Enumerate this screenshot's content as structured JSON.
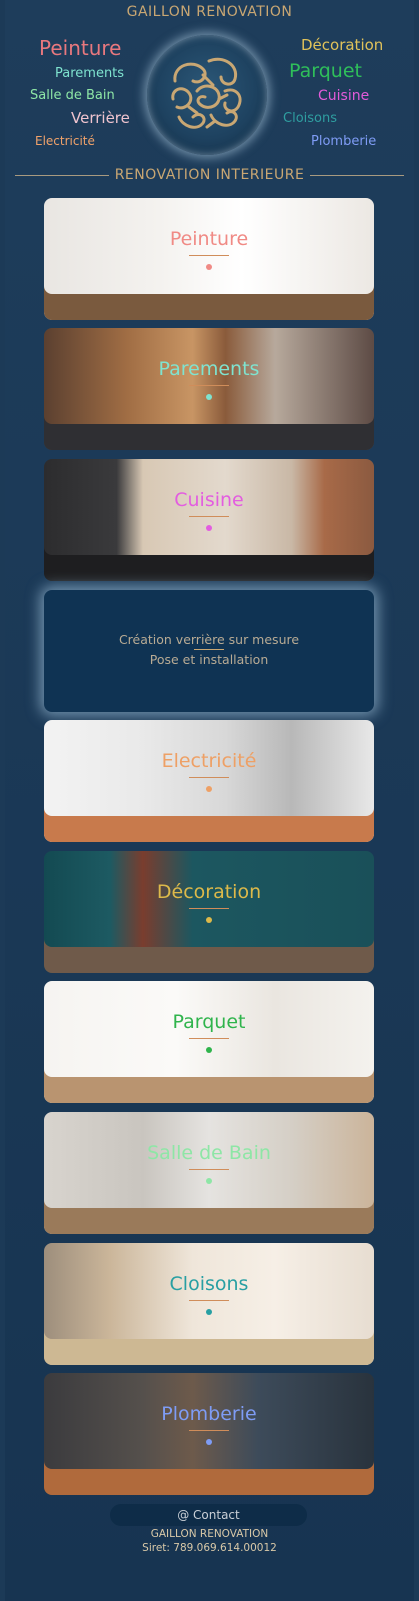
{
  "header": {
    "title": "GAILLON RENOVATION"
  },
  "services_left": [
    {
      "label": "Peinture",
      "color": "#e8787e"
    },
    {
      "label": "Parements",
      "color": "#7fe3cf"
    },
    {
      "label": "Salle de Bain",
      "color": "#8ee6a6"
    },
    {
      "label": "Verrière",
      "color": "#f0c4cf"
    },
    {
      "label": "Electricité",
      "color": "#f0a26a"
    }
  ],
  "services_right": [
    {
      "label": "Décoration",
      "color": "#e0c25a"
    },
    {
      "label": "Parquet",
      "color": "#2fbf5a"
    },
    {
      "label": "Cuisine",
      "color": "#e25bd9"
    },
    {
      "label": "Cloisons",
      "color": "#2f9ea0"
    },
    {
      "label": "Plomberie",
      "color": "#7f9cf5"
    }
  ],
  "section": {
    "title": "RENOVATION INTERIEURE"
  },
  "cards": [
    {
      "label": "Peinture",
      "color": "#f08a85",
      "dot": "#f08a85",
      "bg": "linear-gradient(90deg,#e9e6e2 0%,#f4f2ef 35%,#ffffff 60%,#ece8e3 100%)",
      "floor": "#7a5a3e"
    },
    {
      "label": "Parements",
      "color": "#7fe3cf",
      "dot": "#7fe3cf",
      "bg": "linear-gradient(90deg,#5b4030 0%,#a06d44 25%,#c89564 45%,#8a5b3b 55%,#b7a99c 70%,#5d4b45 100%)",
      "floor": "#2f2f33"
    },
    {
      "label": "Cuisine",
      "color": "#e35de0",
      "dot": "#e35de0",
      "bg": "linear-gradient(90deg,#2c2c2e 0%,#3a3a3c 22%,#d8c8b4 30%,#e3d9cd 55%,#c9b8a6 75%,#a86a48 85%,#8b5a40 100%)",
      "floor": "#1e1e20"
    },
    {
      "label": "Electricité",
      "color": "#eea065",
      "dot": "#eea065",
      "bg": "linear-gradient(90deg,#f3f3f3 0%,#e9e9e9 30%,#d8d8d8 55%,#b8b8b8 75%,#e8e8e8 100%)",
      "floor": "#c87a4c"
    },
    {
      "label": "Décoration",
      "color": "#ddb94a",
      "dot": "#ddb94a",
      "bg": "linear-gradient(90deg,#134a52 0%,#1d5a62 20%,#7a3d2e 30%,#1c5760 45%,#1a5059 100%)",
      "floor": "#6f5a4a"
    },
    {
      "label": "Parquet",
      "color": "#2fb44c",
      "dot": "#2fb44c",
      "bg": "linear-gradient(90deg,#f6f4f1 0%,#fbfaf8 40%,#eae6e0 70%,#f4f2ee 100%)",
      "floor": "#b99470"
    },
    {
      "label": "Salle de Bain",
      "color": "#8ee6a6",
      "dot": "#8ee6a6",
      "bg": "linear-gradient(90deg,#d8d4ce 0%,#c9c5bf 30%,#e5e3e0 50%,#d5cfc6 75%,#cbb49a 100%)",
      "floor": "#9a7a5a"
    },
    {
      "label": "Cloisons",
      "color": "#279fa3",
      "dot": "#279fa3",
      "bg": "linear-gradient(90deg,#9d8e7c 0%,#cbb69a 20%,#efe6da 45%,#f6efe6 70%,#e7ddd1 100%)",
      "floor": "#cdb893"
    },
    {
      "label": "Plomberie",
      "color": "#7e9cf5",
      "dot": "#7e9cf5",
      "bg": "linear-gradient(90deg,#3b3b3e 0%,#55504c 30%,#6d5a4b 45%,#3d4b5a 65%,#29333d 100%)",
      "floor": "#b06a3c"
    }
  ],
  "verriere": {
    "line1": "Création verrière sur mesure",
    "line2": "Pose et installation"
  },
  "contact": {
    "label": "@ Contact"
  },
  "footer": {
    "company": "GAILLON RENOVATION",
    "siret": "Siret: 789.069.614.00012"
  }
}
